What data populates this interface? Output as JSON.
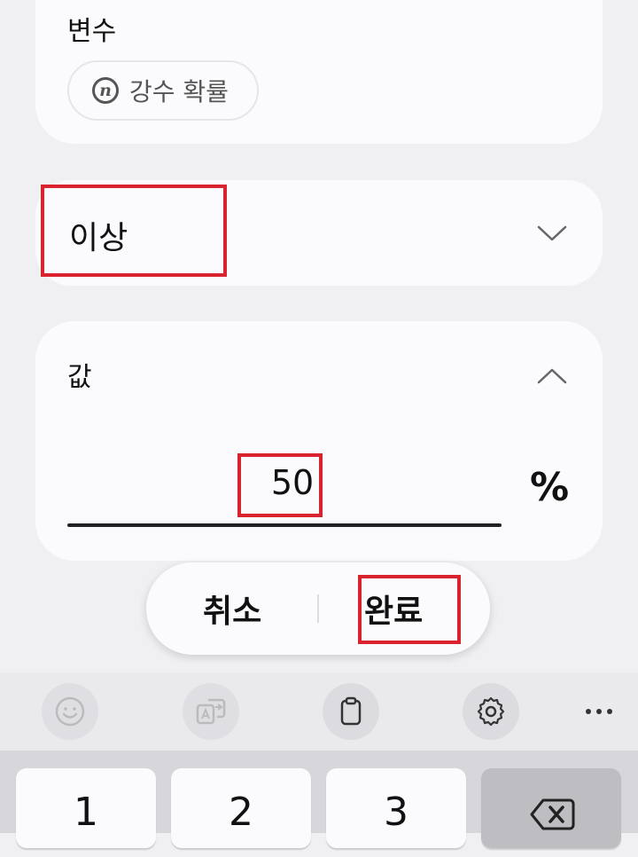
{
  "variable_card": {
    "label": "변수",
    "chip_label": "강수 확률",
    "chip_icon": "n-variable-icon"
  },
  "condition_card": {
    "selected": "이상",
    "chevron": "chevron-down-icon"
  },
  "value_card": {
    "label": "값",
    "value": "50",
    "unit": "%",
    "chevron": "chevron-up-icon"
  },
  "actions": {
    "cancel": "취소",
    "done": "완료"
  },
  "keyboard": {
    "toolbar_icons": [
      "emoji-icon",
      "translate-icon",
      "clipboard-icon",
      "settings-icon",
      "more-icon"
    ],
    "keys": [
      "1",
      "2",
      "3"
    ],
    "delete_icon": "backspace-icon"
  },
  "colors": {
    "highlight": "#d9232e",
    "card": "#fbfbfd",
    "background": "#f0f0f3"
  }
}
